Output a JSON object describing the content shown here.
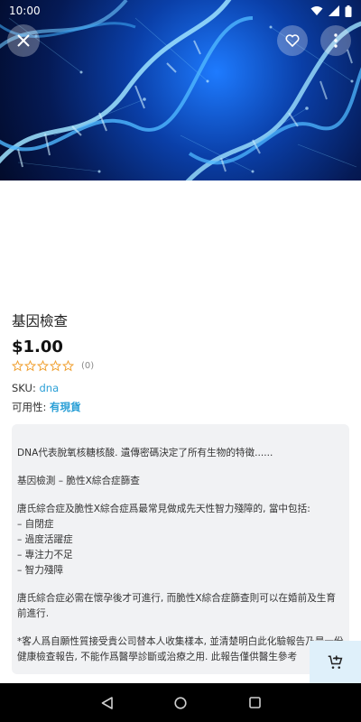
{
  "status_bar": {
    "time": "10:00"
  },
  "product": {
    "title": "基因檢查",
    "price": "$1.00",
    "rating": 0,
    "review_count": "(0)",
    "sku_label": "SKU: ",
    "sku_value": "dna",
    "availability_label": "可用性: ",
    "availability_value": "有現貨"
  },
  "description": [
    "DNA代表脫氧核糖核酸. 遺傳密碼決定了所有生物的特徵......",
    "基因檢測 – 脆性X綜合症篩查",
    "唐氏綜合症及脆性X綜合症爲最常見做成先天性智力殘障的, 當中包括:\n– 自閉症\n– 過度活躍症\n– 專注力不足\n– 智力殘障",
    "唐氏綜合症必需在懷孕後才可進行, 而脆性X綜合症篩查則可以在婚前及生育前進行.",
    "*客人爲自願性質接受貴公司替本人收集樣本, 並清楚明白此化驗報告乃是一份健康檢查報告, 不能作爲醫學診斷或治療之用. 此報告僅供醫生參考"
  ],
  "colors": {
    "accent": "#2a9fd6",
    "star": "#f0a030",
    "card_bg": "#f1f2f4",
    "cart_bg": "#dff0fa"
  },
  "icons": {
    "close": "close-icon",
    "favorite": "heart-icon",
    "more": "more-vert-icon",
    "cart": "add-to-cart-icon",
    "nav": [
      "back-icon",
      "home-icon",
      "recents-icon"
    ]
  }
}
